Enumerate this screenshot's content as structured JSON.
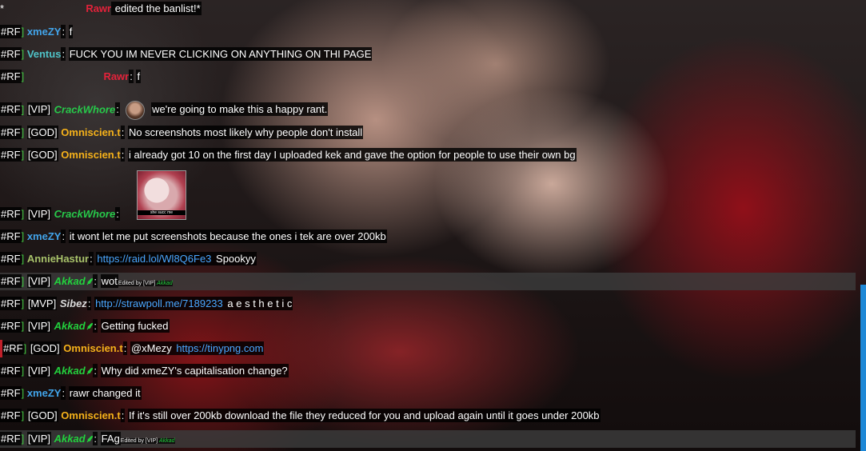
{
  "system": {
    "prefix": "*",
    "name": "Rawr",
    "text": " edited the banlist!*"
  },
  "chat": [
    {
      "tag": "#RF",
      "rank": "",
      "name": "xmeZY",
      "cls": "n-xmezy",
      "text": "f"
    },
    {
      "tag": "#RF",
      "rank": "",
      "name": "Ventus",
      "cls": "n-ventus",
      "text": "FUCK YOU IM NEVER CLICKING ON ANYTHING ON THI PAGE"
    },
    {
      "tag": "#RF",
      "rank": "",
      "name": "Rawr",
      "cls": "n-rawr",
      "text": "f"
    },
    {
      "tag": "#RF",
      "rank": "[VIP]",
      "name": "CrackWhore",
      "cls": "n-crack",
      "text": "we're going to make this a happy rant."
    },
    {
      "tag": "#RF",
      "rank": "[GOD]",
      "name": "Omniscien.t",
      "cls": "n-omni",
      "text": "No screenshots most likely why people don't install"
    },
    {
      "tag": "#RF",
      "rank": "[GOD]",
      "name": "Omniscien.t",
      "cls": "n-omni",
      "text": "i already got 10 on the first day I uploaded kek and gave the option for people to use their own bg"
    },
    {
      "tag": "#RF",
      "rank": "[VIP]",
      "name": "CrackWhore",
      "cls": "n-crack",
      "text": "",
      "image_caption": "she succ me"
    },
    {
      "tag": "#RF",
      "rank": "",
      "name": "xmeZY",
      "cls": "n-xmezy",
      "text": "it wont let me put screenshots because the ones i tek are over 200kb"
    },
    {
      "tag": "#RF",
      "rank": "",
      "name": "AnnieHastur",
      "cls": "n-annie",
      "link": "https://raid.lol/Wl8Q6Fe3",
      "text": " Spookyy"
    },
    {
      "tag": "#RF",
      "rank": "[VIP]",
      "name": "Akkad",
      "cls": "n-akkad",
      "text": "wot",
      "edited": "Edited by [VIP] ",
      "edited_name": "Akkad"
    },
    {
      "tag": "#RF",
      "rank": "[MVP]",
      "name": "Sibez",
      "cls": "n-sibez",
      "link": "http://strawpoll.me/7189233",
      "text": " a e s t h e t i c"
    },
    {
      "tag": "#RF",
      "rank": "[VIP]",
      "name": "Akkad",
      "cls": "n-akkad",
      "text": "Getting fucked"
    },
    {
      "tag": "#RF",
      "rank": "[GOD]",
      "name": "Omniscien.t",
      "cls": "n-omni",
      "text": "@xMezy ",
      "link": "https://tinypng.com"
    },
    {
      "tag": "#RF",
      "rank": "[VIP]",
      "name": "Akkad",
      "cls": "n-akkad",
      "text": "Why did xmeZY's capitalisation change?"
    },
    {
      "tag": "#RF",
      "rank": "",
      "name": "xmeZY",
      "cls": "n-xmezy",
      "text": "rawr changed it"
    },
    {
      "tag": "#RF",
      "rank": "[GOD]",
      "name": "Omniscien.t",
      "cls": "n-omni",
      "text": "If it's still over 200kb download the file they reduced for you and upload again until it goes under 200kb"
    },
    {
      "tag": "#RF",
      "rank": "[VIP]",
      "name": "Akkad",
      "cls": "n-akkad",
      "text": "FAg",
      "edited": "Edited by [VIP] ",
      "edited_name": "Akkad"
    }
  ]
}
